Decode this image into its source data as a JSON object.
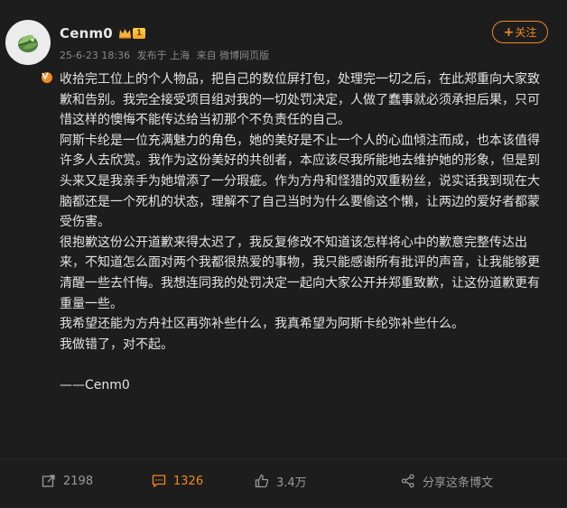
{
  "user": {
    "name": "Cenm0",
    "level": "1"
  },
  "meta": {
    "date": "25-6-23 18:36",
    "location": "发布于 上海",
    "source": "来自 微博网页版"
  },
  "follow_button": {
    "plus": "+",
    "label": "关注"
  },
  "post": {
    "paragraphs": [
      "收拾完工位上的个人物品，把自己的数位屏打包，处理完一切之后，在此郑重向大家致歉和告别。我完全接受项目组对我的一切处罚决定，人做了蠢事就必须承担后果，只可惜这样的懊悔不能传达给当初那个不负责任的自己。",
      "阿斯卡纶是一位充满魅力的角色，她的美好是不止一个人的心血倾注而成，也本该值得许多人去欣赏。我作为这份美好的共创者，本应该尽我所能地去维护她的形象，但是到头来又是我亲手为她增添了一分瑕疵。作为方舟和怪猎的双重粉丝，说实话我到现在大脑都还是一个死机的状态，理解不了自己当时为什么要偷这个懒，让两边的爱好者都蒙受伤害。",
      "很抱歉这份公开道歉来得太迟了，我反复修改不知道该怎样将心中的歉意完整传达出来，不知道怎么面对两个我都很热爱的事物，我只能感谢所有批评的声音，让我能够更清醒一些去忏悔。我想连同我的处罚决定一起向大家公开并郑重致歉，让这份道歉更有重量一些。",
      "我希望还能为方舟社区再弥补些什么，我真希望为阿斯卡纶弥补些什么。",
      "我做错了，对不起。"
    ],
    "signature": "——Cenm0"
  },
  "actions": {
    "repost": "2198",
    "comment": "1326",
    "like": "3.4万",
    "share": "分享这条博文"
  },
  "colors": {
    "accent": "#f08a24",
    "background": "#1d1d1d",
    "text": "#e3e3e3",
    "muted": "#8a8a8a"
  },
  "icons": [
    "avatar-leaf-icon",
    "verified-icon",
    "crown-icon",
    "repost-icon",
    "comment-icon",
    "like-icon",
    "share-icon"
  ]
}
